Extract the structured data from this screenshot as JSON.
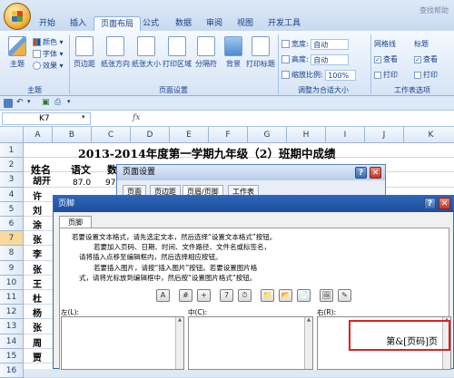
{
  "ribbon": {
    "tabs": [
      "开始",
      "插入",
      "页面布局",
      "公式",
      "数据",
      "审阅",
      "视图",
      "开发工具"
    ],
    "active_tab": "页面布局",
    "search_hint": "查找帮助",
    "theme_group": {
      "theme_label": "主题",
      "colors": "颜色",
      "fonts": "字体",
      "effects": "效果",
      "group_label": "主题"
    },
    "page_setup": {
      "buttons": [
        "页边距",
        "纸张方向",
        "纸张大小",
        "打印区域",
        "分隔符",
        "背景",
        "打印标题"
      ],
      "group_label": "页面设置"
    },
    "scale_fit": {
      "width_label": "宽度:",
      "width_value": "自动",
      "height_label": "高度:",
      "height_value": "自动",
      "scale_label": "缩放比例:",
      "scale_value": "100%",
      "group_label": "调整为合适大小"
    },
    "sheet_options": {
      "gridlines": "网格线",
      "headings": "标题",
      "view": "查看",
      "print": "打印",
      "group_label": "工作表选项"
    }
  },
  "formula_bar": {
    "name_box": "K7",
    "fx": "fx"
  },
  "sheet": {
    "columns": [
      "A",
      "B",
      "C",
      "D",
      "E",
      "F",
      "G",
      "H",
      "I",
      "J",
      "K"
    ],
    "rows": [
      "1",
      "2",
      "3",
      "4",
      "5",
      "6",
      "7",
      "8",
      "9",
      "10",
      "11",
      "12",
      "13",
      "14",
      "15",
      "16"
    ],
    "title": "2013-2014年度第一学期九年级（2）班期中成绩",
    "header_row": [
      "姓名",
      "语文",
      "数"
    ],
    "col_a": [
      "胡开",
      "许",
      "刘",
      "涂",
      "张",
      "李",
      "张",
      "王",
      "杜",
      "杨",
      "张",
      "周",
      "贾"
    ],
    "row3_b": "87.0",
    "row3_c": "97"
  },
  "page_setup_dialog": {
    "title": "页面设置",
    "tabs": [
      "页面",
      "页边距",
      "页眉/页脚",
      "工作表"
    ]
  },
  "footer_dialog": {
    "title": "页脚",
    "tab": "页脚",
    "instructions": [
      "若要设置文本格式，请先选定文本，然后选择“设置文本格式”按钮。",
      "若要加入页码、日期、时间、文件路径、文件名或标签名，",
      "请将插入点移至编辑框内，然后选择相应按钮。",
      "若要插入图片，请按“插入图片”按钮。若要设置图片格",
      "式，请将光标放到编辑框中，然后按“设置图片格式”按钮。"
    ],
    "toolbar_buttons": [
      "A",
      "#",
      "+",
      "7",
      "⏱",
      "📁",
      "📂",
      "📄",
      "🖼",
      "✎"
    ],
    "left_label": "左(L):",
    "center_label": "中(C):",
    "right_label": "右(R):",
    "right_value": "第&[页码]页"
  },
  "colors": {
    "highlight": "#e02020",
    "title_bar": "#2c65b8"
  }
}
